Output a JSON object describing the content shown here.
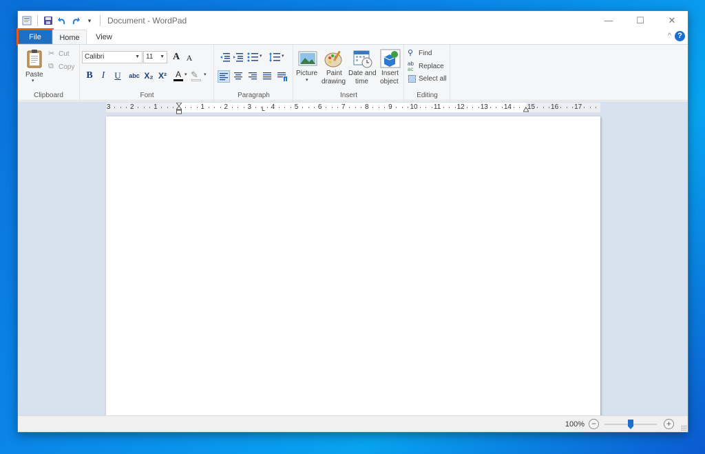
{
  "window": {
    "title": "Document - WordPad",
    "controls": {
      "minimize": "—",
      "maximize": "☐",
      "close": "✕"
    }
  },
  "quick_access": {
    "items": [
      "app-menu",
      "save",
      "undo",
      "redo",
      "customize"
    ],
    "customize_glyph": "▾"
  },
  "tabs": [
    {
      "label": "File",
      "state": "highlighted"
    },
    {
      "label": "Home",
      "state": "selected"
    },
    {
      "label": "View",
      "state": "normal"
    }
  ],
  "ribbon_misc": {
    "collapse_glyph": "^",
    "help_glyph": "?"
  },
  "ribbon": {
    "clipboard": {
      "label": "Clipboard",
      "paste": "Paste",
      "cut": "Cut",
      "copy": "Copy"
    },
    "font": {
      "label": "Font",
      "family": "Calibri",
      "size": "11",
      "buttons": {
        "bold": "B",
        "italic": "I",
        "underline": "U",
        "strike": "abc",
        "sub": "X₂",
        "sup": "X²",
        "color": "A",
        "grow": "A",
        "shrink": "A"
      }
    },
    "paragraph": {
      "label": "Paragraph",
      "alignment_selected": "left"
    },
    "insert": {
      "label": "Insert",
      "picture": "Picture",
      "paint_line1": "Paint",
      "paint_line2": "drawing",
      "date_line1": "Date and",
      "date_line2": "time",
      "object_line1": "Insert",
      "object_line2": "object"
    },
    "editing": {
      "label": "Editing",
      "find": "Find",
      "replace": "Replace",
      "select_all": "Select all"
    }
  },
  "ruler": {
    "left_numbers": [
      "3",
      "2",
      "1"
    ],
    "right_numbers": [
      "1",
      "2",
      "3",
      "4",
      "5",
      "6",
      "7",
      "8",
      "9",
      "10",
      "11",
      "12",
      "13",
      "14",
      "15",
      "16",
      "17"
    ]
  },
  "status": {
    "zoom_level": "100%",
    "zoom_fraction": 0.5,
    "zoom_out": "−",
    "zoom_in": "+"
  },
  "colors": {
    "accent": "#1a6fc7",
    "file_highlight_outline": "#e85a1a",
    "desktop": "#0a86e8"
  }
}
